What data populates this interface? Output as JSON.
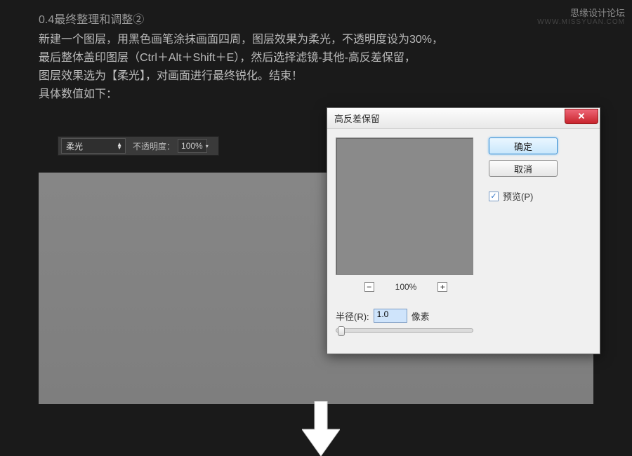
{
  "watermark": "思缘设计论坛",
  "watermark_url": "WWW.MISSYUAN.COM",
  "heading": "0.4最终整理和调整②",
  "paragraph_1": "新建一个图层，用黑色画笔涂抹画面四周，图层效果为柔光，不透明度设为30%，",
  "paragraph_2": "最后整体盖印图层（Ctrl＋Alt＋Shift＋E），然后选择滤镜-其他-高反差保留，",
  "paragraph_3": "图层效果选为【柔光】，对画面进行最终锐化。结束！",
  "paragraph_4": "具体数值如下：",
  "toolbar": {
    "blend_mode": "柔光",
    "opacity_label": "不透明度：",
    "opacity_value": "100%"
  },
  "dialog": {
    "title": "高反差保留",
    "ok": "确定",
    "cancel": "取消",
    "preview_label": "预览(P)",
    "preview_checked": "✓",
    "zoom_level": "100%",
    "radius_label": "半径(R):",
    "radius_value": "1.0",
    "radius_unit": "像素"
  }
}
